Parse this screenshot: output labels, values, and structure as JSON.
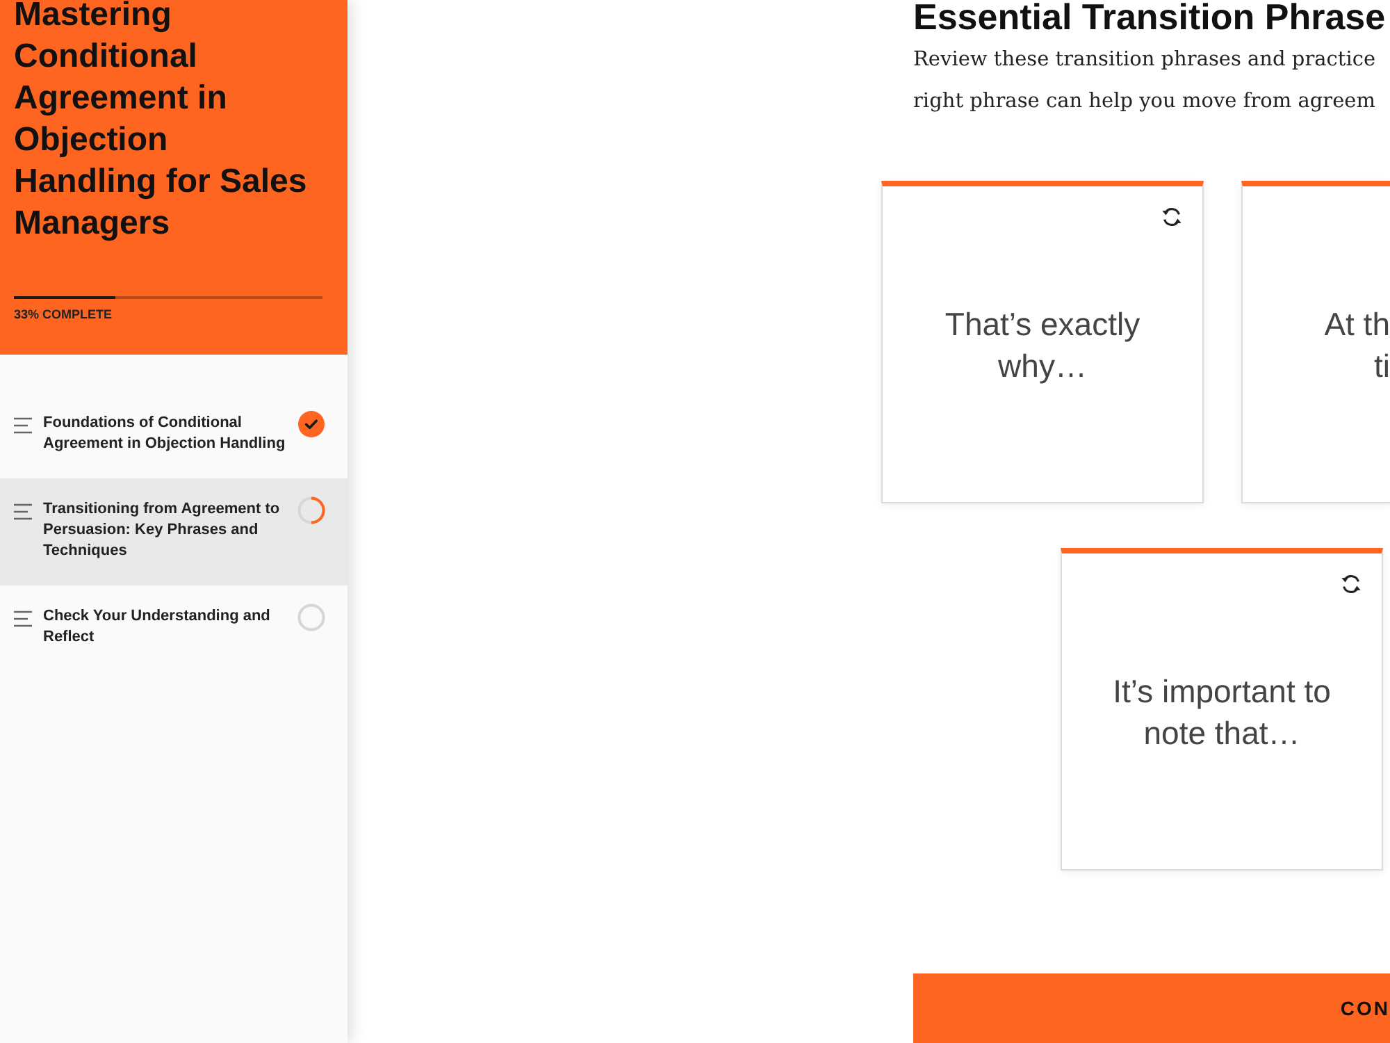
{
  "course": {
    "title": "Mastering Conditional Agreement in Objection Handling for Sales Managers",
    "progress": {
      "level": 0.33,
      "label": "33% COMPLETE"
    }
  },
  "lessons": [
    {
      "title": "Foundations of Conditional Agreement in Objection Handling",
      "kind": "complete",
      "selected": false
    },
    {
      "title": "Transitioning from Agreement to Persuasion: Key Phrases and Techniques",
      "kind": "started",
      "selected": true
    },
    {
      "title": "Check Your Understanding and Reflect",
      "kind": "unstarted",
      "selected": false
    }
  ],
  "content": {
    "heading": "Essential Transition Phrase",
    "intro_lines": [
      "Review these transition phrases and practice",
      "right phrase can help you move from agreem"
    ],
    "card_rows": [
      [
        {
          "text": "That’s exactly why…"
        },
        {
          "text": "At th ti"
        }
      ],
      [
        {
          "text": "It’s important to note that…"
        }
      ]
    ],
    "continue_button": {
      "label": "CON"
    }
  }
}
